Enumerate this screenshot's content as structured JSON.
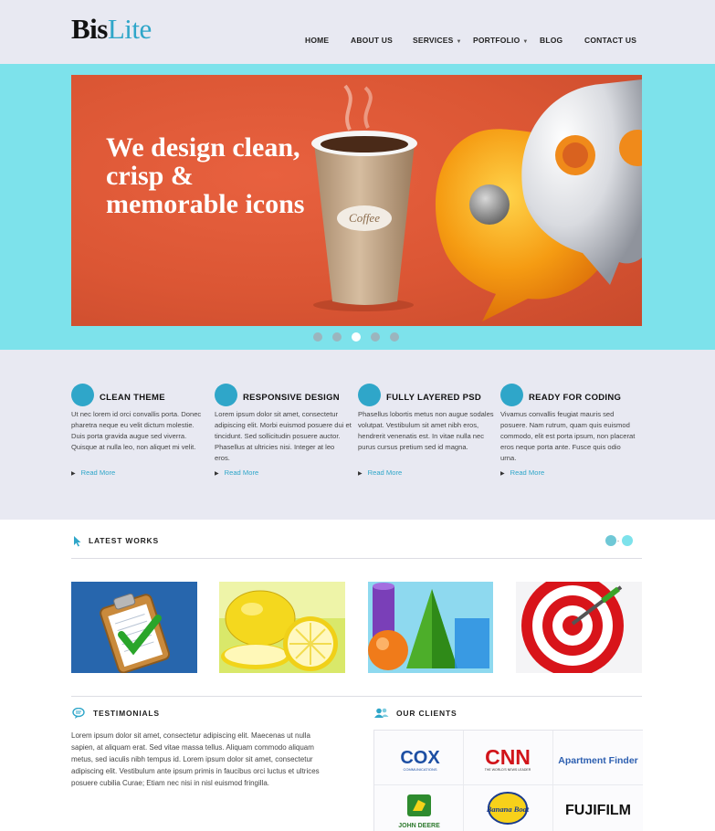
{
  "logo": {
    "part1": "Bis",
    "part2": "Lite"
  },
  "nav": {
    "items": [
      {
        "label": "HOME",
        "has_dropdown": false
      },
      {
        "label": "ABOUT US",
        "has_dropdown": false
      },
      {
        "label": "SERVICES",
        "has_dropdown": true
      },
      {
        "label": "PORTFOLIO",
        "has_dropdown": true
      },
      {
        "label": "BLOG",
        "has_dropdown": false
      },
      {
        "label": "CONTACT US",
        "has_dropdown": false
      }
    ]
  },
  "hero": {
    "title": "We design clean, crisp & memorable icons",
    "cup_label": "Coffee",
    "slide_count": 5,
    "active_slide": 3
  },
  "features": [
    {
      "title": "CLEAN THEME",
      "text": "Ut nec lorem id orci convallis porta. Donec pharetra neque eu velit dictum molestie. Duis porta gravida augue sed viverra. Quisque at nulla leo, non aliquet mi velit.",
      "more": "Read More"
    },
    {
      "title": "RESPONSIVE DESIGN",
      "text": "Lorem ipsum dolor sit amet, consectetur adipiscing elit. Morbi euismod posuere dui et tincidunt. Sed sollicitudin posuere auctor. Phasellus at ultricies nisi. Integer at leo eros.",
      "more": "Read More"
    },
    {
      "title": "FULLY LAYERED PSD",
      "text": "Phasellus lobortis metus non augue sodales volutpat. Vestibulum sit amet nibh eros, hendrerit venenatis est. In vitae nulla nec purus cursus pretium sed id magna.",
      "more": "Read More"
    },
    {
      "title": "READY FOR CODING",
      "text": "Vivamus convallis feugiat mauris sed posuere. Nam rutrum, quam quis euismod commodo, elit est porta ipsum, non placerat eros neque porta ante. Fusce quis odio urna.",
      "more": "Read More"
    }
  ],
  "works": {
    "title": "LATEST WORKS",
    "items": [
      "clipboard-checklist",
      "lemons",
      "geometric-shapes",
      "dartboard-target"
    ]
  },
  "testimonials": {
    "title": "TESTIMONIALS",
    "text": "Lorem ipsum dolor sit amet, consectetur adipiscing elit. Maecenas ut nulla sapien, at aliquam erat. Sed vitae massa tellus. Aliquam commodo aliquam metus, sed iaculis nibh tempus id. Lorem ipsum dolor sit amet, consectetur adipiscing elit. Vestibulum ante ipsum primis in faucibus orci luctus et ultrices posuere cubilia Curae; Etiam nec nisi in nisl euismod fringilla."
  },
  "clients": {
    "title": "OUR CLIENTS",
    "logos": [
      {
        "name": "COX",
        "sub": "COMMUNICATIONS"
      },
      {
        "name": "CNN",
        "sub": "THE WORLD'S NEWS LEADER"
      },
      {
        "name": "Apartment Finder",
        "sub": ""
      },
      {
        "name": "JOHN DEERE",
        "sub": ""
      },
      {
        "name": "Banana Boat",
        "sub": ""
      },
      {
        "name": "FUJIFILM",
        "sub": ""
      }
    ]
  },
  "colors": {
    "accent": "#2fa6c9",
    "hero_bg": "#7de2eb",
    "slide_bg": "#db5634",
    "light_bg": "#e8e9f2"
  }
}
